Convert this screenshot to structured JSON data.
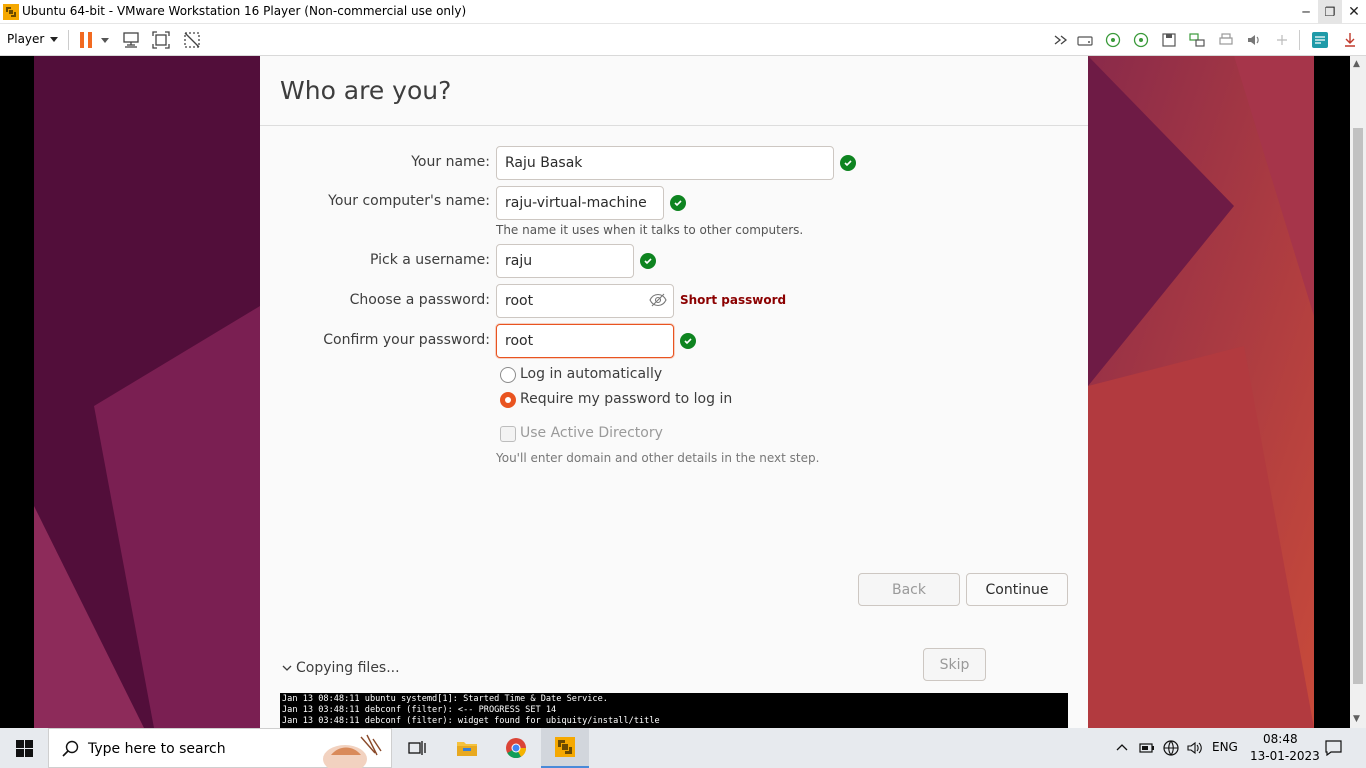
{
  "window": {
    "title": "Ubuntu 64-bit - VMware Workstation 16 Player (Non-commercial use only)",
    "minimize": "─",
    "maximize": "❐",
    "close": "✕"
  },
  "toolbar": {
    "player_label": "Player",
    "icons": [
      "pause-icon",
      "send-ctrl-alt-del-icon",
      "fit-guest-icon",
      "unity-icon",
      "more-chevron-icon",
      "hdd-icon",
      "cd-icon",
      "cd2-icon",
      "floppy-icon",
      "network-icon",
      "printer-icon",
      "sound-icon",
      "usb-icon",
      "message-icon",
      "device-icon"
    ]
  },
  "installer": {
    "page_title": "Who are you?",
    "fields": {
      "name": {
        "label": "Your name:",
        "value": "Raju Basak"
      },
      "computer": {
        "label": "Your computer's name:",
        "value": "raju-virtual-machine",
        "hint": "The name it uses when it talks to other computers."
      },
      "username": {
        "label": "Pick a username:",
        "value": "raju"
      },
      "password": {
        "label": "Choose a password:",
        "value": "root",
        "strength": "Short password"
      },
      "confirm": {
        "label": "Confirm your password:",
        "value": "root"
      }
    },
    "login_options": {
      "auto": "Log in automatically",
      "require": "Require my password to log in",
      "selected": "require"
    },
    "active_directory": {
      "label": "Use Active Directory",
      "hint": "You'll enter domain and other details in the next step."
    },
    "buttons": {
      "back": "Back",
      "continue": "Continue",
      "skip": "Skip"
    },
    "progress_label": "Copying files...",
    "log_lines": [
      "Jan 13 08:48:11 ubuntu systemd[1]: Started Time & Date Service.",
      "Jan 13 03:48:11 debconf (filter): <-- PROGRESS SET 14",
      "Jan 13 03:48:11 debconf (filter): widget found for ubiquity/install/title"
    ]
  },
  "taskbar": {
    "search_placeholder": "Type here to search",
    "language": "ENG",
    "time": "08:48",
    "date": "13-01-2023",
    "pinned": [
      "task-view-icon",
      "file-explorer-icon",
      "chrome-icon",
      "vmware-icon"
    ]
  },
  "colors": {
    "ubuntu_orange": "#e95420",
    "success_green": "#0e8420",
    "error_red": "#8b0000"
  }
}
